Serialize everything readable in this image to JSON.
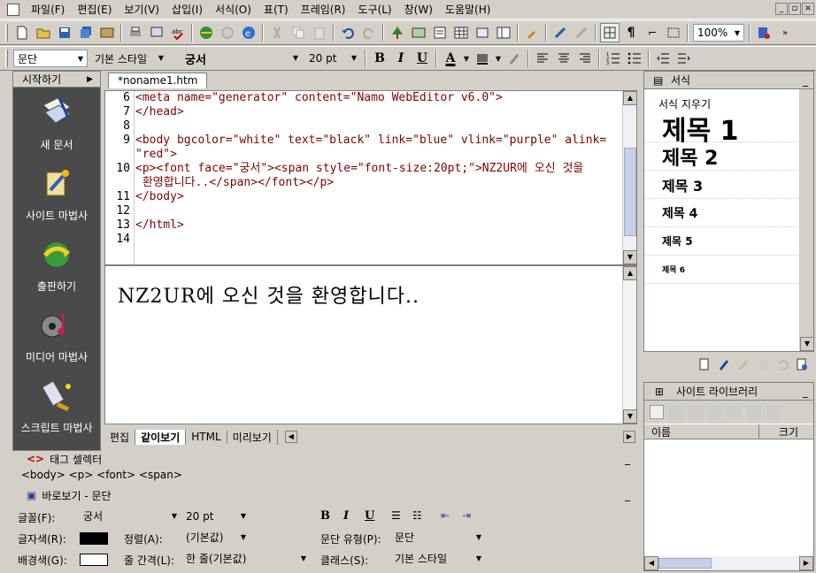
{
  "menu": [
    "파일(F)",
    "편집(E)",
    "보기(V)",
    "삽입(I)",
    "서식(O)",
    "표(T)",
    "프레임(R)",
    "도구(L)",
    "창(W)",
    "도움말(H)"
  ],
  "toolbar2": {
    "para_combo": "문단",
    "style_combo": "기본 스타일",
    "font_combo": "궁서",
    "size_combo": "20 pt",
    "bold": "B",
    "italic": "I",
    "underline": "U",
    "fontcolor": "A"
  },
  "toolbar1": {
    "zoom": "100%"
  },
  "left_panel": {
    "header": "시작하기",
    "items": [
      {
        "label": "새 문서",
        "icon": "new-document-icon"
      },
      {
        "label": "사이트 마법사",
        "icon": "site-wizard-icon"
      },
      {
        "label": "출판하기",
        "icon": "publish-icon"
      },
      {
        "label": "미디어 마법사",
        "icon": "media-wizard-icon"
      },
      {
        "label": "스크립트 마법사",
        "icon": "script-wizard-icon"
      }
    ]
  },
  "editor": {
    "tab_title": "*noname1.htm",
    "line_numbers": [
      "6",
      "7",
      "8",
      "9",
      "",
      "10",
      "",
      "11",
      "12",
      "13",
      "14"
    ],
    "code_lines": [
      "<meta name=\"generator\" content=\"Namo WebEditor v6.0\">",
      "</head>",
      "",
      "<body bgcolor=\"white\" text=\"black\" link=\"blue\" vlink=\"purple\" alink=",
      "\"red\">",
      "<p><font face=\"궁서\"><span style=\"font-size:20pt;\">NZ2UR에 오신 것을",
      " 환영합니다..</span></font></p>",
      "</body>",
      "",
      "</html>",
      ""
    ],
    "preview_text": "NZ2UR에 오신 것을 환영합니다..",
    "bottom_tabs": [
      "편집",
      "같이보기",
      "HTML",
      "미리보기"
    ]
  },
  "right_panel": {
    "title": "서식",
    "clear_label": "서식 지우기",
    "headings": [
      "제목 1",
      "제목 2",
      "제목 3",
      "제목 4",
      "제목 5",
      "제목 6"
    ],
    "library_title": "사이트 라이브러리",
    "col_name": "이름",
    "col_size": "크기"
  },
  "tag_selector": {
    "title": "태그 셀렉터",
    "path": "<body> <p> <font> <span>"
  },
  "properties": {
    "title": "바로보기 - 문단",
    "font_label": "글꼴(F):",
    "font_value": "궁서",
    "size_value": "20 pt",
    "textcolor_label": "글자색(R):",
    "align_label": "정렬(A):",
    "align_value": "(기본값)",
    "paratype_label": "문단 유형(P):",
    "paratype_value": "문단",
    "bgcolor_label": "배경색(G):",
    "linespacing_label": "줄 간격(L):",
    "linespacing_value": "한 줄(기본값)",
    "class_label": "클래스(S):",
    "class_value": "기본 스타일",
    "text_color": "#000000",
    "bg_color": "#ffffff"
  }
}
